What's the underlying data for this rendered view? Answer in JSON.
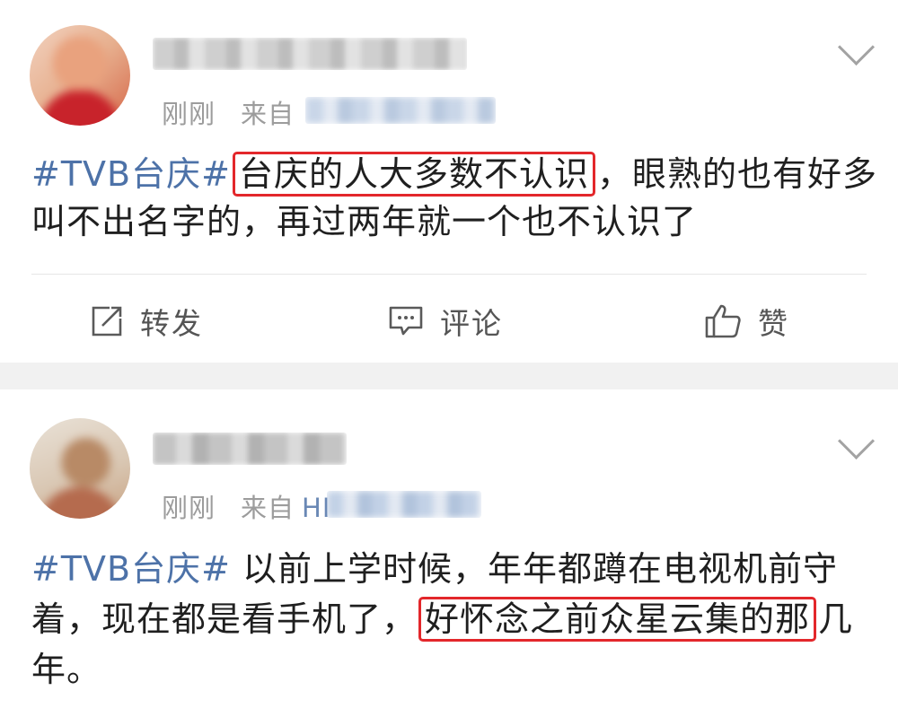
{
  "posts": [
    {
      "time": "刚刚",
      "from_label": "来自",
      "source_partial": "",
      "hashtag": "#TVB台庆#",
      "text_highlight": "台庆的人大多数不认识",
      "text_after": "，眼熟的也有好多叫不出名字的，再过两年就一个也不认识了",
      "actions": {
        "repost": "转发",
        "comment": "评论",
        "like": "赞"
      }
    },
    {
      "time": "刚刚",
      "from_label": "来自",
      "source_partial": "HI",
      "hashtag": "#TVB台庆#",
      "text_before": " 以前上学时候，年年都蹲在电视机前守着，现在都是看手机了，",
      "text_highlight": "好怀念之前众星云集的那",
      "text_after": "几年。"
    }
  ],
  "colors": {
    "hashtag": "#4d72a8",
    "highlight_box": "#e3272b",
    "meta_gray": "#9c9c9c",
    "separator": "#f1f1f1"
  }
}
